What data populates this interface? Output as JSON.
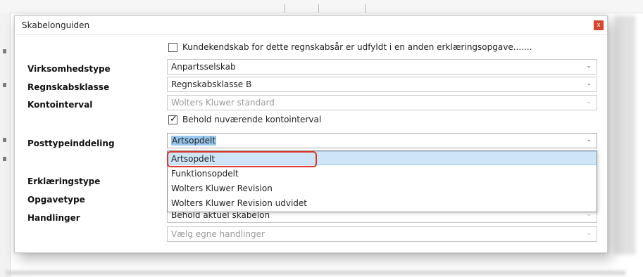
{
  "dialog": {
    "title": "Skabelonguiden",
    "close_label": "x"
  },
  "top_checkbox": {
    "checked": false,
    "label": "Kundekendskab for dette regnskabsår er udfyldt i en anden erklæringsopgave......."
  },
  "fields": {
    "virksomhedstype": {
      "label": "Virksomhedstype",
      "value": "Anpartsselskab"
    },
    "regnskabsklasse": {
      "label": "Regnskabsklasse",
      "value": "Regnskabsklasse B"
    },
    "kontointerval": {
      "label": "Kontointerval",
      "value": "Wolters Kluwer standard",
      "disabled": true
    },
    "posttypeinddeling": {
      "label": "Posttypeinddeling",
      "value": "Artsopdelt"
    },
    "erklaeringstype": {
      "label": "Erklæringstype"
    },
    "opgavetype": {
      "label": "Opgavetype"
    },
    "handlinger": {
      "label": "Handlinger",
      "value": "Behold aktuel skabelon",
      "secondary_value": "Vælg egne handlinger"
    }
  },
  "keep_interval_checkbox": {
    "checked": true,
    "label": "Behold nuværende kontointerval"
  },
  "dropdown": {
    "options": [
      "Artsopdelt",
      "Funktionsopdelt",
      "Wolters Kluwer Revision",
      "Wolters Kluwer Revision udvidet"
    ],
    "selected": "Artsopdelt"
  },
  "icons": {
    "chevron": "chevron-down-icon",
    "check": "checkmark-icon",
    "close": "close-icon"
  },
  "colors": {
    "close_button": "#d7452f",
    "selection_highlight": "#99c7ee",
    "selected_option": "#cde5f7",
    "annotation": "#d9382c"
  }
}
